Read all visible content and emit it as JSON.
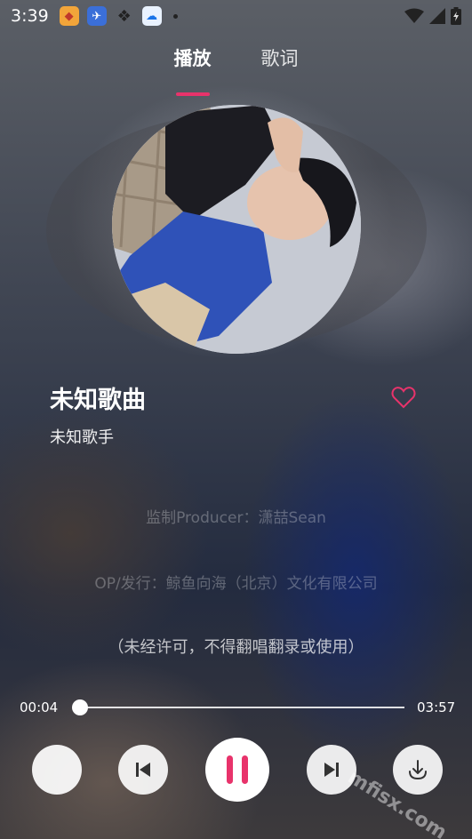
{
  "status_bar": {
    "time": "3:39"
  },
  "tabs": [
    {
      "label": "播放",
      "active": true
    },
    {
      "label": "歌词",
      "active": false
    }
  ],
  "song": {
    "title": "未知歌曲",
    "artist": "未知歌手",
    "favorited": false
  },
  "lyrics": [
    "监制Producer：潇喆Sean",
    "OP/发行：鲸鱼向海（北京）文化有限公司",
    "（未经许可，不得翻唱翻录或使用）"
  ],
  "player": {
    "current_time": "00:04",
    "total_time": "03:57",
    "progress": 0.017,
    "state": "playing"
  },
  "watermark": "mfisx.com",
  "colors": {
    "accent": "#e8336b",
    "heart": "#e8336b"
  },
  "icons": {
    "prev": "skip-previous-icon",
    "play_pause": "pause-icon",
    "next": "skip-next-icon",
    "download": "download-icon",
    "favorite": "heart-outline-icon"
  }
}
